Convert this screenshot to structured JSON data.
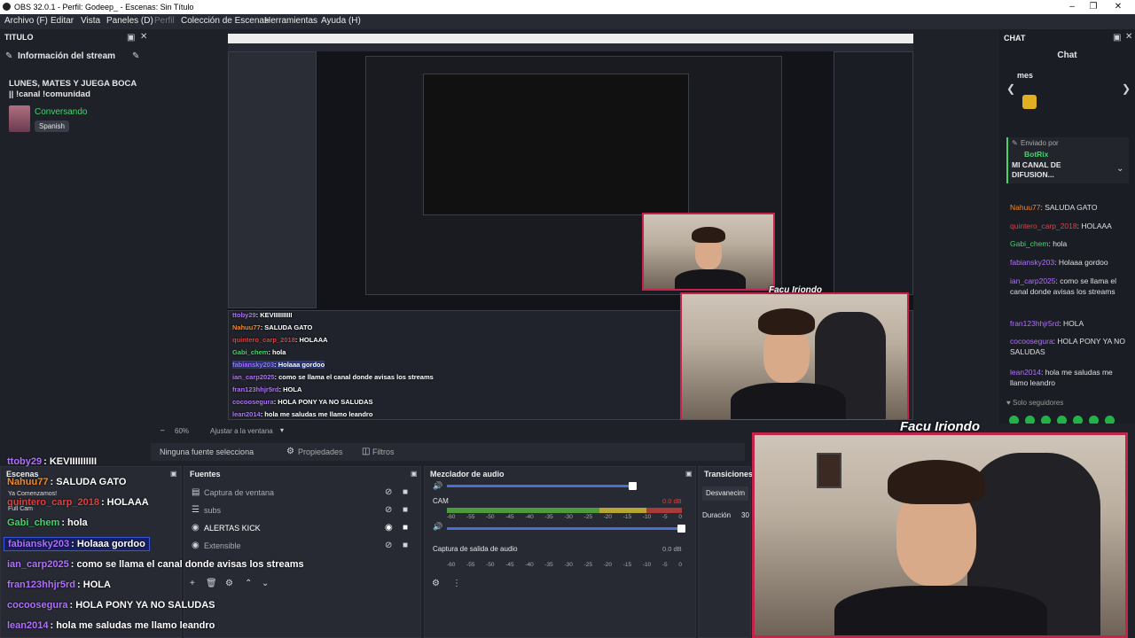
{
  "window": {
    "title": "OBS 32.0.1 - Perfil: Godeep_ - Escenas: Sin Título"
  },
  "menu": [
    "Archivo (F)",
    "Editar",
    "Vista",
    "Paneles (D)",
    "Perfil",
    "Colección de Escenas",
    "Herramientas",
    "Ayuda (H)"
  ],
  "left_dock": {
    "title": "TITULO",
    "section": "Información del stream",
    "stream_title": "LUNES, MATES Y JUEGA BOCA || !canal !comunidad",
    "category": "Conversando",
    "language": "Spanish"
  },
  "right_dock": {
    "title": "CHAT",
    "chat_header": "Chat",
    "top_label": "mes",
    "pinned_by": "Enviado por",
    "pinned_user": "BotRix",
    "pinned_message": "MI CANAL DE DIFUSION...",
    "messages": [
      {
        "user": "Nahuu77",
        "text": ": SALUDA GATO",
        "color": "#f08a2b"
      },
      {
        "user": "quintero_carp_2018",
        "text": ": HOLAAA",
        "color": "#e04040"
      },
      {
        "user": "Gabi_chem",
        "text": ": hola",
        "color": "#46d36b"
      },
      {
        "user": "fabiansky203",
        "text": ": Holaaa gordoo",
        "color": "#b070ff"
      },
      {
        "user": "ian_carp2025",
        "text": ": como se llama el canal donde avisas los streams",
        "color": "#b070ff"
      },
      {
        "user": "fran123hhjr5rd",
        "text": ": HOLA",
        "color": "#b070ff"
      },
      {
        "user": "cocoosegura",
        "text": ": HOLA PONY YA NO SALUDAS",
        "color": "#b070ff"
      },
      {
        "user": "lean2014",
        "text": ": hola me saludas me llamo leandro",
        "color": "#b070ff"
      }
    ],
    "footer": "Solo seguidores"
  },
  "overlay_chat": [
    {
      "user": "ttoby29",
      "text": ": KEVIIIIIIIIII",
      "color": "#b070ff"
    },
    {
      "user": "Nahuu77",
      "text": ": SALUDA GATO",
      "color": "#f08a2b"
    },
    {
      "user": "quintero_carp_2018",
      "text": ": HOLAAA",
      "color": "#e04040"
    },
    {
      "user": "Gabi_chem",
      "text": ": hola",
      "color": "#46d36b"
    },
    {
      "user": "fabiansky203",
      "text": ": Holaaa gordoo",
      "color": "#b070ff"
    },
    {
      "user": "ian_carp2025",
      "text": ": como se llama el canal donde avisas los streams",
      "color": "#b070ff"
    },
    {
      "user": "fran123hhjr5rd",
      "text": ": HOLA",
      "color": "#b070ff"
    },
    {
      "user": "cocoosegura",
      "text": ": HOLA PONY YA NO SALUDAS",
      "color": "#b070ff"
    },
    {
      "user": "lean2014",
      "text": ": hola me saludas me llamo leandro",
      "color": "#b070ff"
    }
  ],
  "preview": {
    "zoom": "60%",
    "fit": "Ajustar a la ventana",
    "cam_tag": "Facu Iriondo"
  },
  "source_toolbar": {
    "no_source": "Ninguna fuente selecciona",
    "properties": "Propiedades",
    "filters": "Filtros"
  },
  "scenes": {
    "title": "Escenas",
    "items": [
      "Ya Comenzamos!",
      "Full Cam"
    ]
  },
  "sources": {
    "title": "Fuentes",
    "items": [
      {
        "name": "Captura de ventana",
        "active": false
      },
      {
        "name": "subs",
        "active": false
      },
      {
        "name": "ALERTAS KICK",
        "active": true
      },
      {
        "name": "Extensible",
        "active": false
      }
    ]
  },
  "mixer": {
    "title": "Mezclador de audio",
    "channels": [
      {
        "name": "CAM",
        "db": "0.0 dB",
        "level": 1.0
      },
      {
        "name": "Captura de salida de audio",
        "db": "0.0 dB",
        "level": 0.0
      }
    ],
    "ticks": [
      "-60",
      "-55",
      "-50",
      "-45",
      "-40",
      "-35",
      "-30",
      "-25",
      "-20",
      "-15",
      "-10",
      "-5",
      "0"
    ]
  },
  "transitions": {
    "title": "Transiciones",
    "type": "Desvanecim",
    "duration_label": "Duración",
    "duration_value": "30"
  },
  "colors": {
    "accent": "#c4234b",
    "chat_green": "#46d36b"
  }
}
